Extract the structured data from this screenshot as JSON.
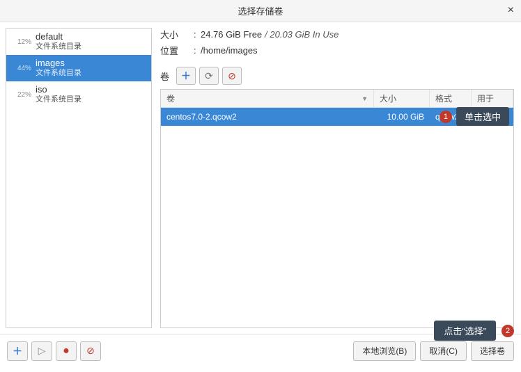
{
  "title": "选择存储卷",
  "pools": [
    {
      "pct": "12%",
      "name": "default",
      "type": "文件系统目录",
      "selected": false
    },
    {
      "pct": "44%",
      "name": "images",
      "type": "文件系统目录",
      "selected": true
    },
    {
      "pct": "22%",
      "name": "iso",
      "type": "文件系统目录",
      "selected": false
    }
  ],
  "info": {
    "size_label": "大小",
    "free": "24.76 GiB Free",
    "inuse": "/ 20.03 GiB In Use",
    "loc_label": "位置",
    "loc_value": "/home/images"
  },
  "vol_label": "卷",
  "columns": {
    "c1": "卷",
    "c2": "大小",
    "c3": "格式",
    "c4": "用于"
  },
  "rows": [
    {
      "name": "centos7.0-2.qcow2",
      "size": "10.00 GiB",
      "fmt": "qcow2",
      "used": ""
    }
  ],
  "annot1": {
    "num": "1",
    "text": "单击选中"
  },
  "annot2": {
    "num": "2",
    "text": "点击“选择”"
  },
  "footer_btns": {
    "browse": "本地浏览(B)",
    "cancel": "取消(C)",
    "choose": "选择卷"
  },
  "icons": {
    "plus": "＋",
    "refresh": "⟳",
    "del": "⊘",
    "play": "▷",
    "rec": "●",
    "sep": ":",
    "sort": "▼"
  }
}
